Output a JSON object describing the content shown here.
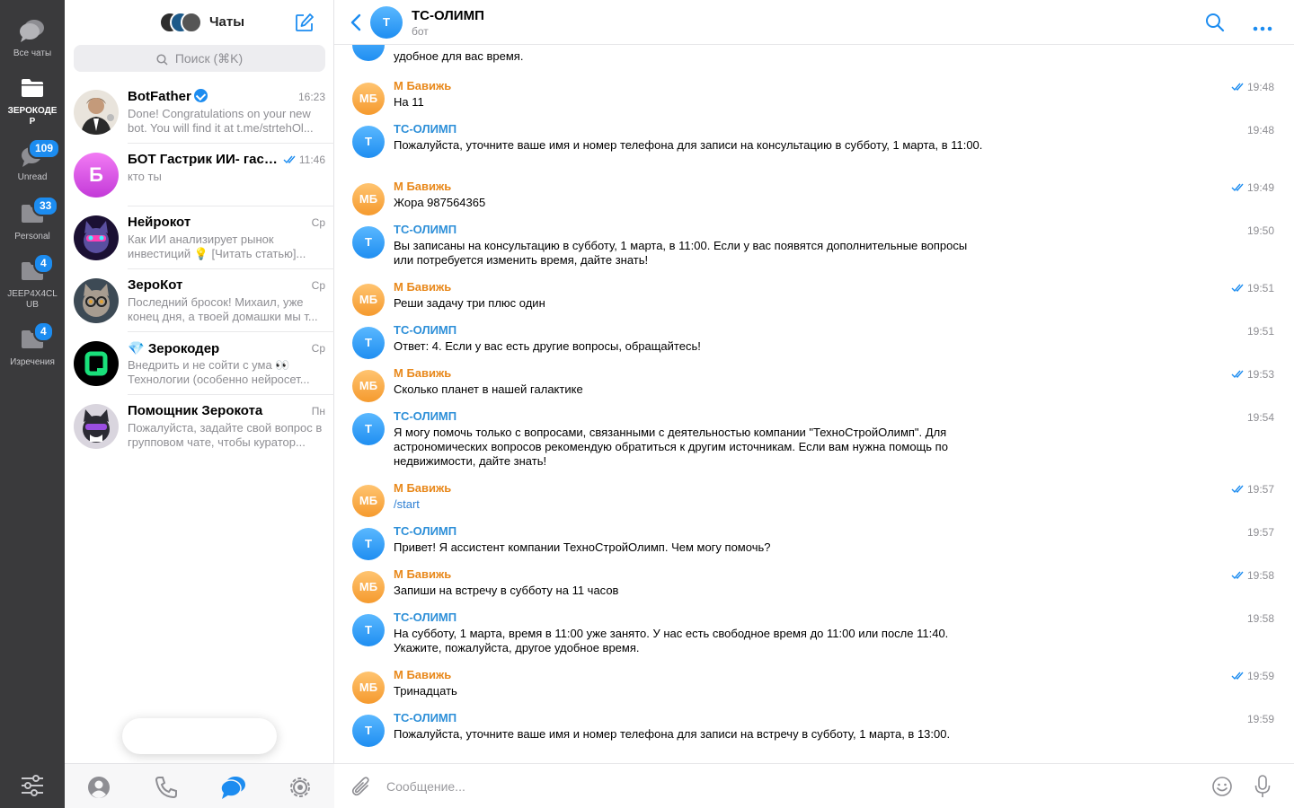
{
  "colors": {
    "accent": "#1c8cf0",
    "rail": "#3a3a3c",
    "user_name": "#e8881b",
    "bot_name": "#2d8fd8"
  },
  "folders": [
    {
      "label": "Все чаты",
      "icon": "chat-bubbles-icon",
      "badge": ""
    },
    {
      "label": "ЗЕРОКОДЕР",
      "icon": "folder-icon",
      "badge": "",
      "active": true
    },
    {
      "label": "Unread",
      "icon": "chat-bubble-icon",
      "badge": "109"
    },
    {
      "label": "Personal",
      "icon": "folder-icon",
      "badge": "33"
    },
    {
      "label": "JEEP4X4CLUB",
      "icon": "folder-icon",
      "badge": "4"
    },
    {
      "label": "Изречения",
      "icon": "folder-icon",
      "badge": "4"
    }
  ],
  "list": {
    "title": "Чаты",
    "search_placeholder": "Поиск (⌘K)",
    "chats": [
      {
        "name": "BotFather",
        "time": "16:23",
        "preview": "Done! Congratulations on your new bot. You will find it at t.me/strtehOl...",
        "verified": true
      },
      {
        "name": "БОТ Гастрик ИИ- гаст...",
        "time": "11:46",
        "preview": "кто ты",
        "avatar_letter": "Б",
        "read": true
      },
      {
        "name": "Нейрокот",
        "time": "Ср",
        "preview": "Как ИИ анализирует рынок инвестиций 💡 [Читать статью]..."
      },
      {
        "name": "ЗероКот",
        "time": "Ср",
        "preview": "Последний бросок! Михаил, уже конец дня, а твоей домашки мы т..."
      },
      {
        "name": "💎 Зерокодер",
        "time": "Ср",
        "preview": "Внедрить и не сойти с ума 👀 Технологии (особенно нейросет..."
      },
      {
        "name": "Помощник Зерокота",
        "time": "Пн",
        "preview": "Пожалуйста, задайте свой вопрос в групповом чате, чтобы куратор..."
      }
    ]
  },
  "conversation": {
    "title": "ТС-ОЛИМП",
    "subtitle": "бот",
    "avatar_letter": "Т",
    "partial_message": "удобное для вас время.",
    "messages": [
      {
        "from": "user",
        "initials": "МБ",
        "sender": "М Бавижь",
        "text": "На 11",
        "time": "19:48",
        "read": true
      },
      {
        "from": "bot",
        "initials": "Т",
        "sender": "ТС-ОЛИМП",
        "text": "Пожалуйста, уточните ваше имя и номер телефона для записи на консультацию в субботу, 1 марта, в 11:00.",
        "time": "19:48"
      },
      {
        "from": "user",
        "initials": "МБ",
        "sender": "М Бавижь",
        "text": "Жора 987564365",
        "time": "19:49",
        "read": true
      },
      {
        "from": "bot",
        "initials": "Т",
        "sender": "ТС-ОЛИМП",
        "text": "Вы записаны на консультацию в субботу, 1 марта, в 11:00. Если у вас появятся дополнительные вопросы или потребуется изменить время, дайте знать!",
        "time": "19:50"
      },
      {
        "from": "user",
        "initials": "МБ",
        "sender": "М Бавижь",
        "text": "Реши задачу три плюс один",
        "time": "19:51",
        "read": true
      },
      {
        "from": "bot",
        "initials": "Т",
        "sender": "ТС-ОЛИМП",
        "text": "Ответ: 4. Если у вас есть другие вопросы, обращайтесь!",
        "time": "19:51"
      },
      {
        "from": "user",
        "initials": "МБ",
        "sender": "М Бавижь",
        "text": "Сколько планет в нашей галактике",
        "time": "19:53",
        "read": true
      },
      {
        "from": "bot",
        "initials": "Т",
        "sender": "ТС-ОЛИМП",
        "text": "Я могу помочь только с вопросами, связанными с деятельностью компании \"ТехноСтройОлимп\". Для астрономических вопросов рекомендую обратиться к другим источникам. Если вам нужна помощь по недвижимости, дайте знать!",
        "time": "19:54"
      },
      {
        "from": "user",
        "initials": "МБ",
        "sender": "М Бавижь",
        "text": "/start",
        "time": "19:57",
        "read": true,
        "command": true
      },
      {
        "from": "bot",
        "initials": "Т",
        "sender": "ТС-ОЛИМП",
        "text": "Привет! Я ассистент компании ТехноСтройОлимп. Чем могу помочь?",
        "time": "19:57"
      },
      {
        "from": "user",
        "initials": "МБ",
        "sender": "М Бавижь",
        "text": "Запиши на встречу в субботу на 11 часов",
        "time": "19:58",
        "read": true
      },
      {
        "from": "bot",
        "initials": "Т",
        "sender": "ТС-ОЛИМП",
        "text": "На субботу, 1 марта, время в 11:00 уже занято. У нас есть свободное время до 11:00 или после 11:40. Укажите, пожалуйста, другое удобное время.",
        "time": "19:58"
      },
      {
        "from": "user",
        "initials": "МБ",
        "sender": "М Бавижь",
        "text": "Тринадцать",
        "time": "19:59",
        "read": true
      },
      {
        "from": "bot",
        "initials": "Т",
        "sender": "ТС-ОЛИМП",
        "text": "Пожалуйста, уточните ваше имя и номер телефона для записи на встречу в субботу, 1 марта, в 13:00.",
        "time": "19:59"
      }
    ],
    "composer_placeholder": "Сообщение..."
  }
}
